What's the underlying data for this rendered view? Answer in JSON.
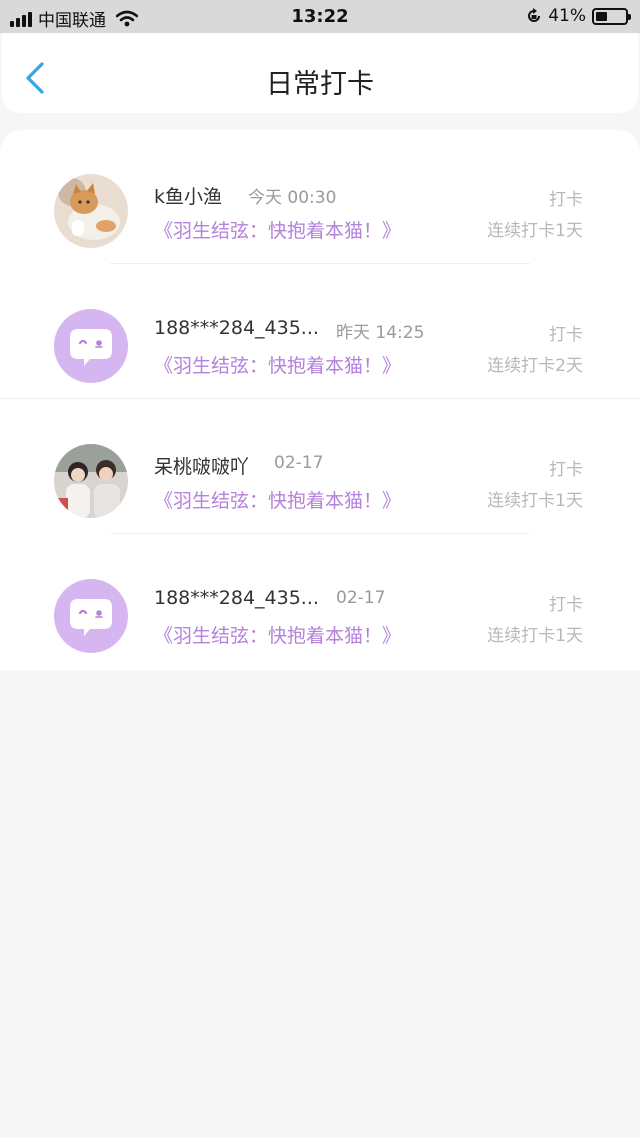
{
  "status_bar": {
    "carrier": "中国联通",
    "time": "13:22",
    "battery": "41%",
    "battery_level": 0.41
  },
  "header": {
    "title": "日常打卡"
  },
  "colors": {
    "accent": "#b481dc",
    "back_arrow": "#35a5e6",
    "avatar_default_bg": "#d6b6f1"
  },
  "entries": [
    {
      "name": "k鱼小渔",
      "time": "今天 00:30",
      "book": "《羽生结弦：快抱着本猫！》",
      "action": "打卡",
      "streak": "连续打卡1天",
      "avatar": "cat-photo-avatar"
    },
    {
      "name": "188***284_435...",
      "time": "昨天 14:25",
      "book": "《羽生结弦：快抱着本猫！》",
      "action": "打卡",
      "streak": "连续打卡2天",
      "avatar": "default-chat-avatar"
    },
    {
      "name": "呆桃啵啵吖",
      "time": "02-17",
      "book": "《羽生结弦：快抱着本猫！》",
      "action": "打卡",
      "streak": "连续打卡1天",
      "avatar": "people-photo-avatar"
    },
    {
      "name": "188***284_435...",
      "time": "02-17",
      "book": "《羽生结弦：快抱着本猫！》",
      "action": "打卡",
      "streak": "连续打卡1天",
      "avatar": "default-chat-avatar"
    }
  ]
}
